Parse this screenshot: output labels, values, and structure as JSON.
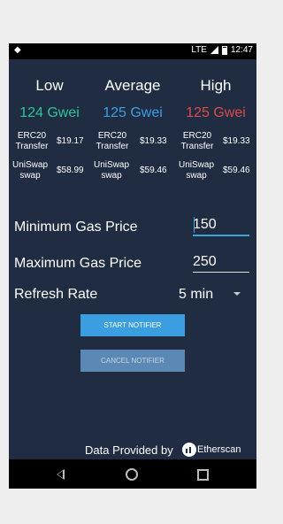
{
  "status_bar": {
    "time": "12:47",
    "lte": "LTE"
  },
  "tiers": [
    {
      "label": "Low",
      "price": "124 Gwei",
      "color": "#2ec4a0"
    },
    {
      "label": "Average",
      "price": "125 Gwei",
      "color": "#3b9ee6"
    },
    {
      "label": "High",
      "price": "125 Gwei",
      "color": "#e04a4a"
    }
  ],
  "costs": [
    {
      "erc20_label": "ERC20\nTransfer",
      "erc20": "$19.17",
      "swap_label": "UniSwap\nswap",
      "swap": "$58.99"
    },
    {
      "erc20_label": "ERC20\nTransfer",
      "erc20": "$19.33",
      "swap_label": "UniSwap\nswap",
      "swap": "$59.46"
    },
    {
      "erc20_label": "ERC20\nTransfer",
      "erc20": "$19.33",
      "swap_label": "UniSwap\nswap",
      "swap": "$59.46"
    }
  ],
  "form": {
    "min_label": "Minimum Gas Price",
    "min_value": "150",
    "max_label": "Maximum Gas Price",
    "max_value": "250",
    "refresh_label": "Refresh Rate",
    "refresh_value": "5 min"
  },
  "buttons": {
    "start": "START NOTIFIER",
    "cancel": "CANCEL NOTIFIER"
  },
  "footer": {
    "credit": "Data Provided by",
    "provider": "Etherscan"
  }
}
